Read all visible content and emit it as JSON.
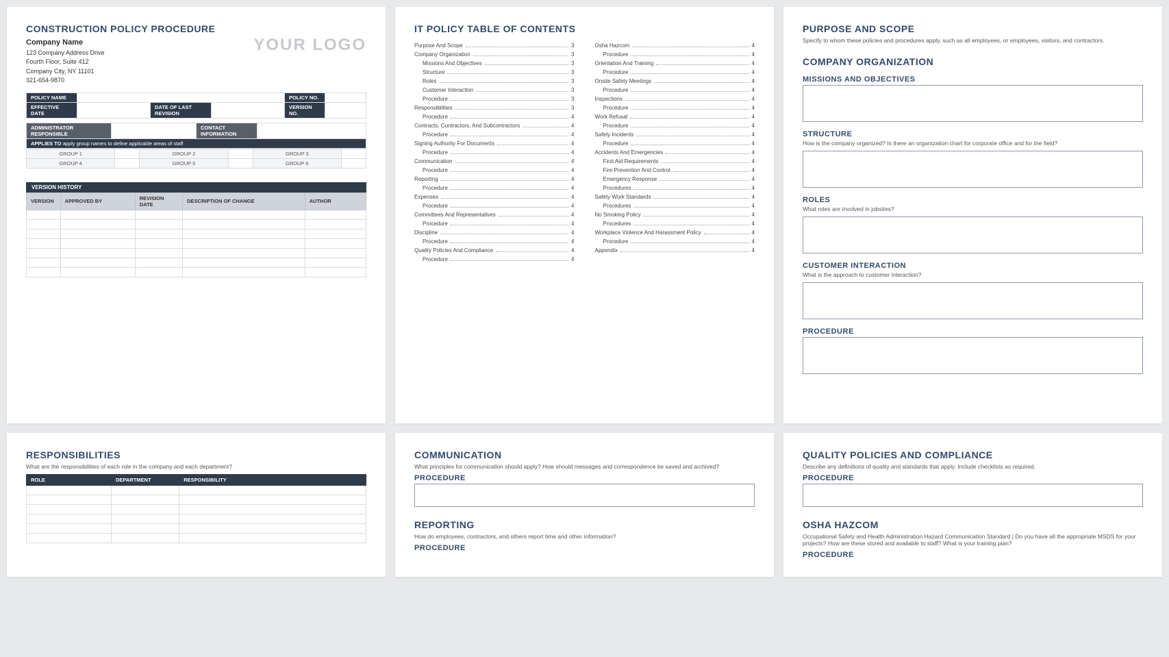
{
  "page1": {
    "title": "CONSTRUCTION POLICY PROCEDURE",
    "company_name": "Company Name",
    "addr1": "123 Company Address Drive",
    "addr2": "Fourth Floor, Suite 412",
    "addr3": "Company City, NY  11101",
    "phone": "321-654-9870",
    "logo": "YOUR LOGO",
    "meta": {
      "policy_name": "POLICY NAME",
      "policy_no": "POLICY NO.",
      "effective_date": "EFFECTIVE DATE",
      "last_rev": "DATE OF LAST REVISION",
      "version_no": "VERSION NO.",
      "admin": "ADMINISTRATOR RESPONSIBLE",
      "contact": "CONTACT INFORMATION",
      "applies_lbl": "APPLIES TO",
      "applies_txt": "apply group names to define applicable areas of staff"
    },
    "groups": [
      "GROUP 1",
      "GROUP 2",
      "GROUP 3",
      "GROUP 4",
      "GROUP 5",
      "GROUP 6"
    ],
    "vh_caption": "VERSION HISTORY",
    "vh_headers": [
      "VERSION",
      "APPROVED BY",
      "REVISION DATE",
      "DESCRIPTION OF CHANGE",
      "AUTHOR"
    ]
  },
  "page2": {
    "title": "IT POLICY TABLE OF CONTENTS",
    "left": [
      {
        "t": "Purpose And Scope",
        "p": "3",
        "s": 0
      },
      {
        "t": "Company Organization",
        "p": "3",
        "s": 0
      },
      {
        "t": "Missions And Objectives",
        "p": "3",
        "s": 1
      },
      {
        "t": "Structure",
        "p": "3",
        "s": 1
      },
      {
        "t": "Roles",
        "p": "3",
        "s": 1
      },
      {
        "t": "Customer Interaction",
        "p": "3",
        "s": 1
      },
      {
        "t": "Procedure",
        "p": "3",
        "s": 1
      },
      {
        "t": "Responsibilities",
        "p": "3",
        "s": 0
      },
      {
        "t": "Procedure",
        "p": "4",
        "s": 1
      },
      {
        "t": "Contracts, Contractors, And Subcontractors",
        "p": "4",
        "s": 0
      },
      {
        "t": "Procedure",
        "p": "4",
        "s": 1
      },
      {
        "t": "Signing Authority For Documents",
        "p": "4",
        "s": 0
      },
      {
        "t": "Procedure",
        "p": "4",
        "s": 1
      },
      {
        "t": "Communication",
        "p": "4",
        "s": 0
      },
      {
        "t": "Procedure",
        "p": "4",
        "s": 1
      },
      {
        "t": "Reporting",
        "p": "4",
        "s": 0
      },
      {
        "t": "Procedure",
        "p": "4",
        "s": 1
      },
      {
        "t": "Expenses",
        "p": "4",
        "s": 0
      },
      {
        "t": "Procedure",
        "p": "4",
        "s": 1
      },
      {
        "t": "Committees And Representatives",
        "p": "4",
        "s": 0
      },
      {
        "t": "Procedure",
        "p": "4",
        "s": 1
      },
      {
        "t": "Discipline",
        "p": "4",
        "s": 0
      },
      {
        "t": "Procedure",
        "p": "4",
        "s": 1
      },
      {
        "t": "Quality Policies And Compliance",
        "p": "4",
        "s": 0
      },
      {
        "t": "Procedure",
        "p": "4",
        "s": 1
      }
    ],
    "right": [
      {
        "t": "Osha Hazcom",
        "p": "4",
        "s": 0
      },
      {
        "t": "Procedure",
        "p": "4",
        "s": 1
      },
      {
        "t": "Orientation And Training",
        "p": "4",
        "s": 0
      },
      {
        "t": "Procedure",
        "p": "4",
        "s": 1
      },
      {
        "t": "Onsite Safety Meetings",
        "p": "4",
        "s": 0
      },
      {
        "t": "Procedure",
        "p": "4",
        "s": 1
      },
      {
        "t": "Inspections",
        "p": "4",
        "s": 0
      },
      {
        "t": "Procedure",
        "p": "4",
        "s": 1
      },
      {
        "t": "Work Refusal",
        "p": "4",
        "s": 0
      },
      {
        "t": "Procedure",
        "p": "4",
        "s": 1
      },
      {
        "t": "Safety Incidents",
        "p": "4",
        "s": 0
      },
      {
        "t": "Procedure",
        "p": "4",
        "s": 1
      },
      {
        "t": "Accidents And Emergencies",
        "p": "4",
        "s": 0
      },
      {
        "t": "First Aid Requirements",
        "p": "4",
        "s": 1
      },
      {
        "t": "Fire Prevention And Control",
        "p": "4",
        "s": 1
      },
      {
        "t": "Emergency Response",
        "p": "4",
        "s": 1
      },
      {
        "t": "Procedures",
        "p": "4",
        "s": 1
      },
      {
        "t": "Safety Work Standards",
        "p": "4",
        "s": 0
      },
      {
        "t": "Procedures",
        "p": "4",
        "s": 1
      },
      {
        "t": "No Smoking Policy",
        "p": "4",
        "s": 0
      },
      {
        "t": "Procedures",
        "p": "4",
        "s": 1
      },
      {
        "t": "Workplace Violence And Harassment Policy",
        "p": "4",
        "s": 0
      },
      {
        "t": "Procedure",
        "p": "4",
        "s": 1
      },
      {
        "t": "Appendix",
        "p": "4",
        "s": 0
      }
    ]
  },
  "page3": {
    "purpose_title": "PURPOSE AND SCOPE",
    "purpose_desc": "Specify to whom these policies and procedures apply, such as all employees, or employees, visitors, and contractors.",
    "org_title": "COMPANY ORGANIZATION",
    "missions": "MISSIONS AND OBJECTIVES",
    "structure": "STRUCTURE",
    "structure_desc": "How is the company organized? Is there an organization chart for corporate office and for the field?",
    "roles": "ROLES",
    "roles_desc": "What roles are involved in jobsites?",
    "cust": "CUSTOMER INTERACTION",
    "cust_desc": "What is the approach to customer interaction?",
    "proc": "PROCEDURE"
  },
  "page4": {
    "title": "RESPONSIBILITIES",
    "desc": "What are the responsibilities of each role in the company and each department?",
    "headers": [
      "ROLE",
      "DEPARTMENT",
      "RESPONSIBILITY"
    ]
  },
  "page5": {
    "comm_title": "COMMUNICATION",
    "comm_desc": "What principles for communication should apply?  How should messages and correspondence be saved and archived?",
    "proc": "PROCEDURE",
    "rep_title": "REPORTING",
    "rep_desc": "How do employees, contractors, and others report time and other information?"
  },
  "page6": {
    "qpc_title": "QUALITY POLICIES AND COMPLIANCE",
    "qpc_desc": "Describe any definitions of quality and standards that apply.  Include checklists as required.",
    "proc": "PROCEDURE",
    "osha_title": "OSHA HAZCOM",
    "osha_desc": "Occupational Safety and Health Administration Hazard Communication Standard |  Do you have all the appropriate MSDS for your projects?  How are these stored and available to staff?  What is your training plan?"
  }
}
